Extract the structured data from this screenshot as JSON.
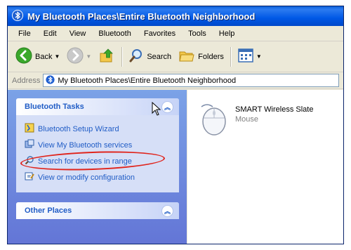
{
  "window": {
    "title": "My Bluetooth Places\\Entire Bluetooth Neighborhood"
  },
  "menubar": {
    "items": [
      "File",
      "Edit",
      "View",
      "Bluetooth",
      "Favorites",
      "Tools",
      "Help"
    ]
  },
  "toolbar": {
    "back_label": "Back",
    "search_label": "Search",
    "folders_label": "Folders"
  },
  "address": {
    "label": "Address",
    "value": "My Bluetooth Places\\Entire Bluetooth Neighborhood"
  },
  "tasks_panel": {
    "title": "Bluetooth Tasks",
    "items": [
      {
        "label": "Bluetooth Setup Wizard",
        "icon": "wizard-icon"
      },
      {
        "label": "View My Bluetooth services",
        "icon": "services-icon"
      },
      {
        "label": "Search for devices in range",
        "icon": "search-devices-icon"
      },
      {
        "label": "View or modify configuration",
        "icon": "configuration-icon"
      }
    ]
  },
  "other_panel": {
    "title": "Other Places"
  },
  "devices": [
    {
      "name": "SMART Wireless Slate",
      "type": "Mouse",
      "icon": "mouse-icon"
    }
  ],
  "colors": {
    "titlebar": "#0058e6",
    "task_link": "#215dc6",
    "highlight_circle": "#e0241c",
    "left_pane": "#6f8ee0"
  }
}
